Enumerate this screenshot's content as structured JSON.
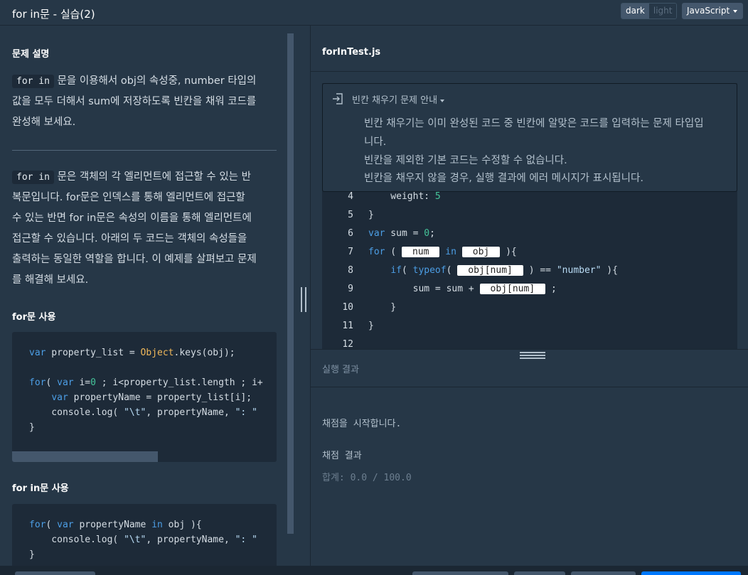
{
  "header": {
    "title": "for in문 - 실습(2)",
    "theme_dark": "dark",
    "theme_light": "light",
    "language": "JavaScript"
  },
  "problem": {
    "title": "문제 설명",
    "para1_code": "for in",
    "para1_l1": "문을 이용해서 obj의 속성중, number 타입의",
    "para1_l2": "값을 모두 더해서 sum에 저장하도록 빈칸을 채워 코드를",
    "para1_l3": "완성해 보세요.",
    "para2_code": "for in",
    "para2_l1": "문은 객체의 각 엘리먼트에 접근할 수 있는 반",
    "para2_l2": "복문입니다. for문은 인덱스를 통해 엘리먼트에 접근할",
    "para2_l3": "수 있는 반면 for in문은 속성의 이름을 통해 엘리먼트에",
    "para2_l4": "접근할 수 있습니다. 아래의 두 코드는 객체의 속성들을",
    "para2_l5": "출력하는 동일한 역할을 합니다. 이 예제를 살펴보고 문제",
    "para2_l6": "를 해결해 보세요.",
    "for_title": "for문 사용",
    "forin_title": "for in문 사용",
    "for_code": {
      "l1": {
        "a": "var",
        "b": " property_list = ",
        "c": "Object",
        "d": ".keys(obj);"
      },
      "l3": {
        "a": "for",
        "b": "( ",
        "c": "var",
        "d": " i=",
        "e": "0",
        "f": " ; i<property_list.length ; i+"
      },
      "l4": {
        "a": "    ",
        "b": "var",
        "c": " propertyName = property_list[i];"
      },
      "l5": {
        "a": "    console.log( ",
        "b": "\"\\t\"",
        "c": ", propertyName, ",
        "d": "\": \""
      },
      "l6": "}"
    },
    "forin_code": {
      "l1": {
        "a": "for",
        "b": "( ",
        "c": "var",
        "d": " propertyName ",
        "e": "in",
        "f": " obj ){"
      },
      "l2": {
        "a": "    console.log( ",
        "b": "\"\\t\"",
        "c": ", propertyName, ",
        "d": "\": \""
      },
      "l3": "}"
    }
  },
  "editor": {
    "filename": "forInTest.js",
    "guide_title": "빈칸 채우기 문제 안내",
    "guide_lines": [
      "빈칸 채우기는 이미 완성된 코드 중 빈칸에 알맞은 코드를 입력하는 문제 타입입",
      "니다.",
      "빈칸을 제외한 기본 코드는 수정할 수 없습니다.",
      "빈칸을 채우지 않을 경우, 실행 결과에 에러 메시지가 표시됩니다."
    ],
    "line_numbers": [
      "4",
      "5",
      "6",
      "7",
      "8",
      "9",
      "10",
      "11",
      "12"
    ],
    "code": {
      "l4": {
        "a": "    weight: ",
        "b": "5"
      },
      "l5": "}",
      "l6": {
        "a": "var",
        "b": " sum = ",
        "c": "0",
        "d": ";"
      },
      "l7": {
        "a": "for",
        "b": " ( ",
        "c": " in ",
        "d": " ){"
      },
      "l8": {
        "a": "    ",
        "b": "if",
        "c": "( ",
        "d": "typeof",
        "e": "( ",
        "f": " ) == ",
        "g": "\"number\"",
        "h": " ){"
      },
      "l9": {
        "a": "        sum = sum + ",
        "b": " ;"
      },
      "l10": "    }",
      "l11": "}"
    },
    "blanks": {
      "b1": "num",
      "b2": "obj",
      "b3": "obj[num]",
      "b4": "obj[num]"
    }
  },
  "result": {
    "label": "실행 결과",
    "start": "채점을 시작합니다.",
    "heading": "채점 결과",
    "total": "합계: 0.0 / 100.0"
  }
}
